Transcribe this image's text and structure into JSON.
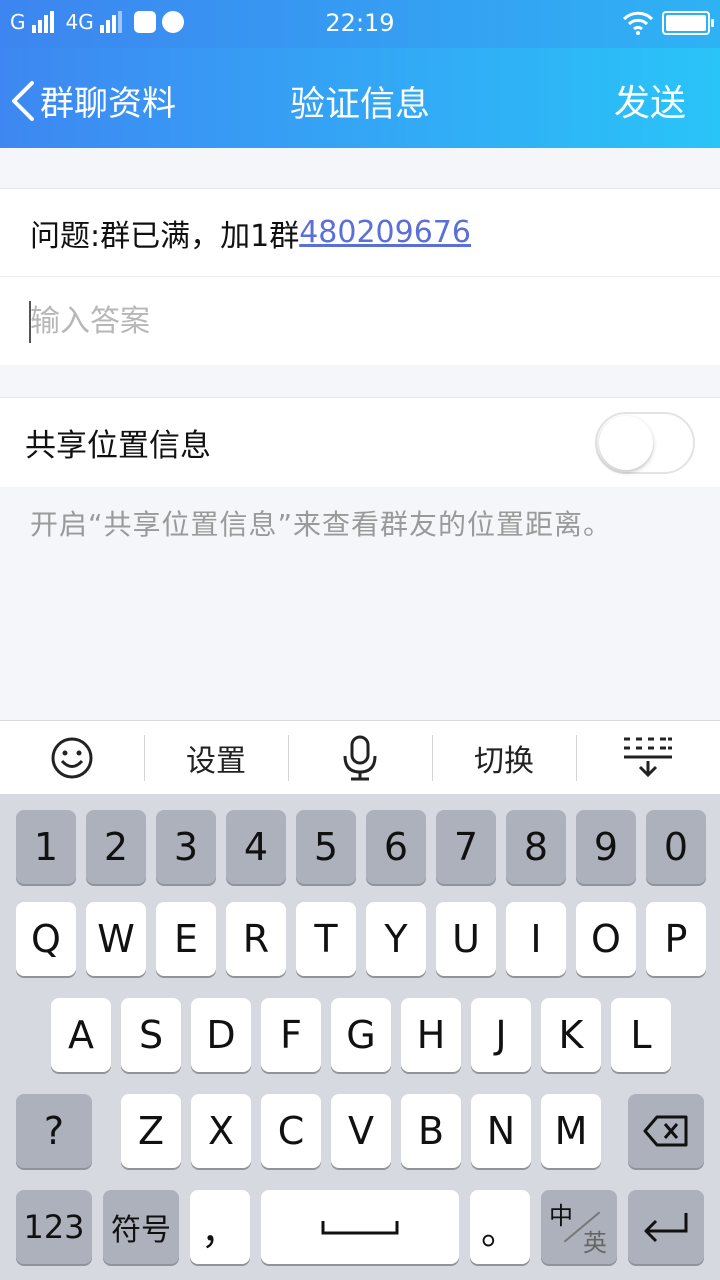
{
  "status_bar": {
    "carrier_left": "G",
    "network": "4G",
    "time": "22:19"
  },
  "nav": {
    "back_label": "群聊资料",
    "title": "验证信息",
    "send_label": "发送"
  },
  "question": {
    "prefix": "问题:群已满，加1群",
    "link": "480209676"
  },
  "answer": {
    "placeholder": "输入答案",
    "value": ""
  },
  "share_location": {
    "label": "共享位置信息",
    "enabled": false,
    "hint": "开启“共享位置信息”来查看群友的位置距离。"
  },
  "keyboard_toolbar": {
    "emoji_icon": "smiley-icon",
    "settings_label": "设置",
    "mic_icon": "microphone-icon",
    "switch_label": "切换",
    "collapse_icon": "keyboard-collapse-icon"
  },
  "keyboard": {
    "num_row": [
      "1",
      "2",
      "3",
      "4",
      "5",
      "6",
      "7",
      "8",
      "9",
      "0"
    ],
    "row1": [
      "Q",
      "W",
      "E",
      "R",
      "T",
      "Y",
      "U",
      "I",
      "O",
      "P"
    ],
    "row2": [
      "A",
      "S",
      "D",
      "F",
      "G",
      "H",
      "J",
      "K",
      "L"
    ],
    "row3_left": "?",
    "row3": [
      "Z",
      "X",
      "C",
      "V",
      "B",
      "N",
      "M"
    ],
    "key_123": "123",
    "key_symbol": "符号",
    "key_comma": "，",
    "key_period": "。",
    "key_zh": "中",
    "key_en": "英"
  },
  "colors": {
    "nav_gradient_start": "#3e87f2",
    "nav_gradient_end": "#29c4f8",
    "link": "#5a6fd8"
  }
}
